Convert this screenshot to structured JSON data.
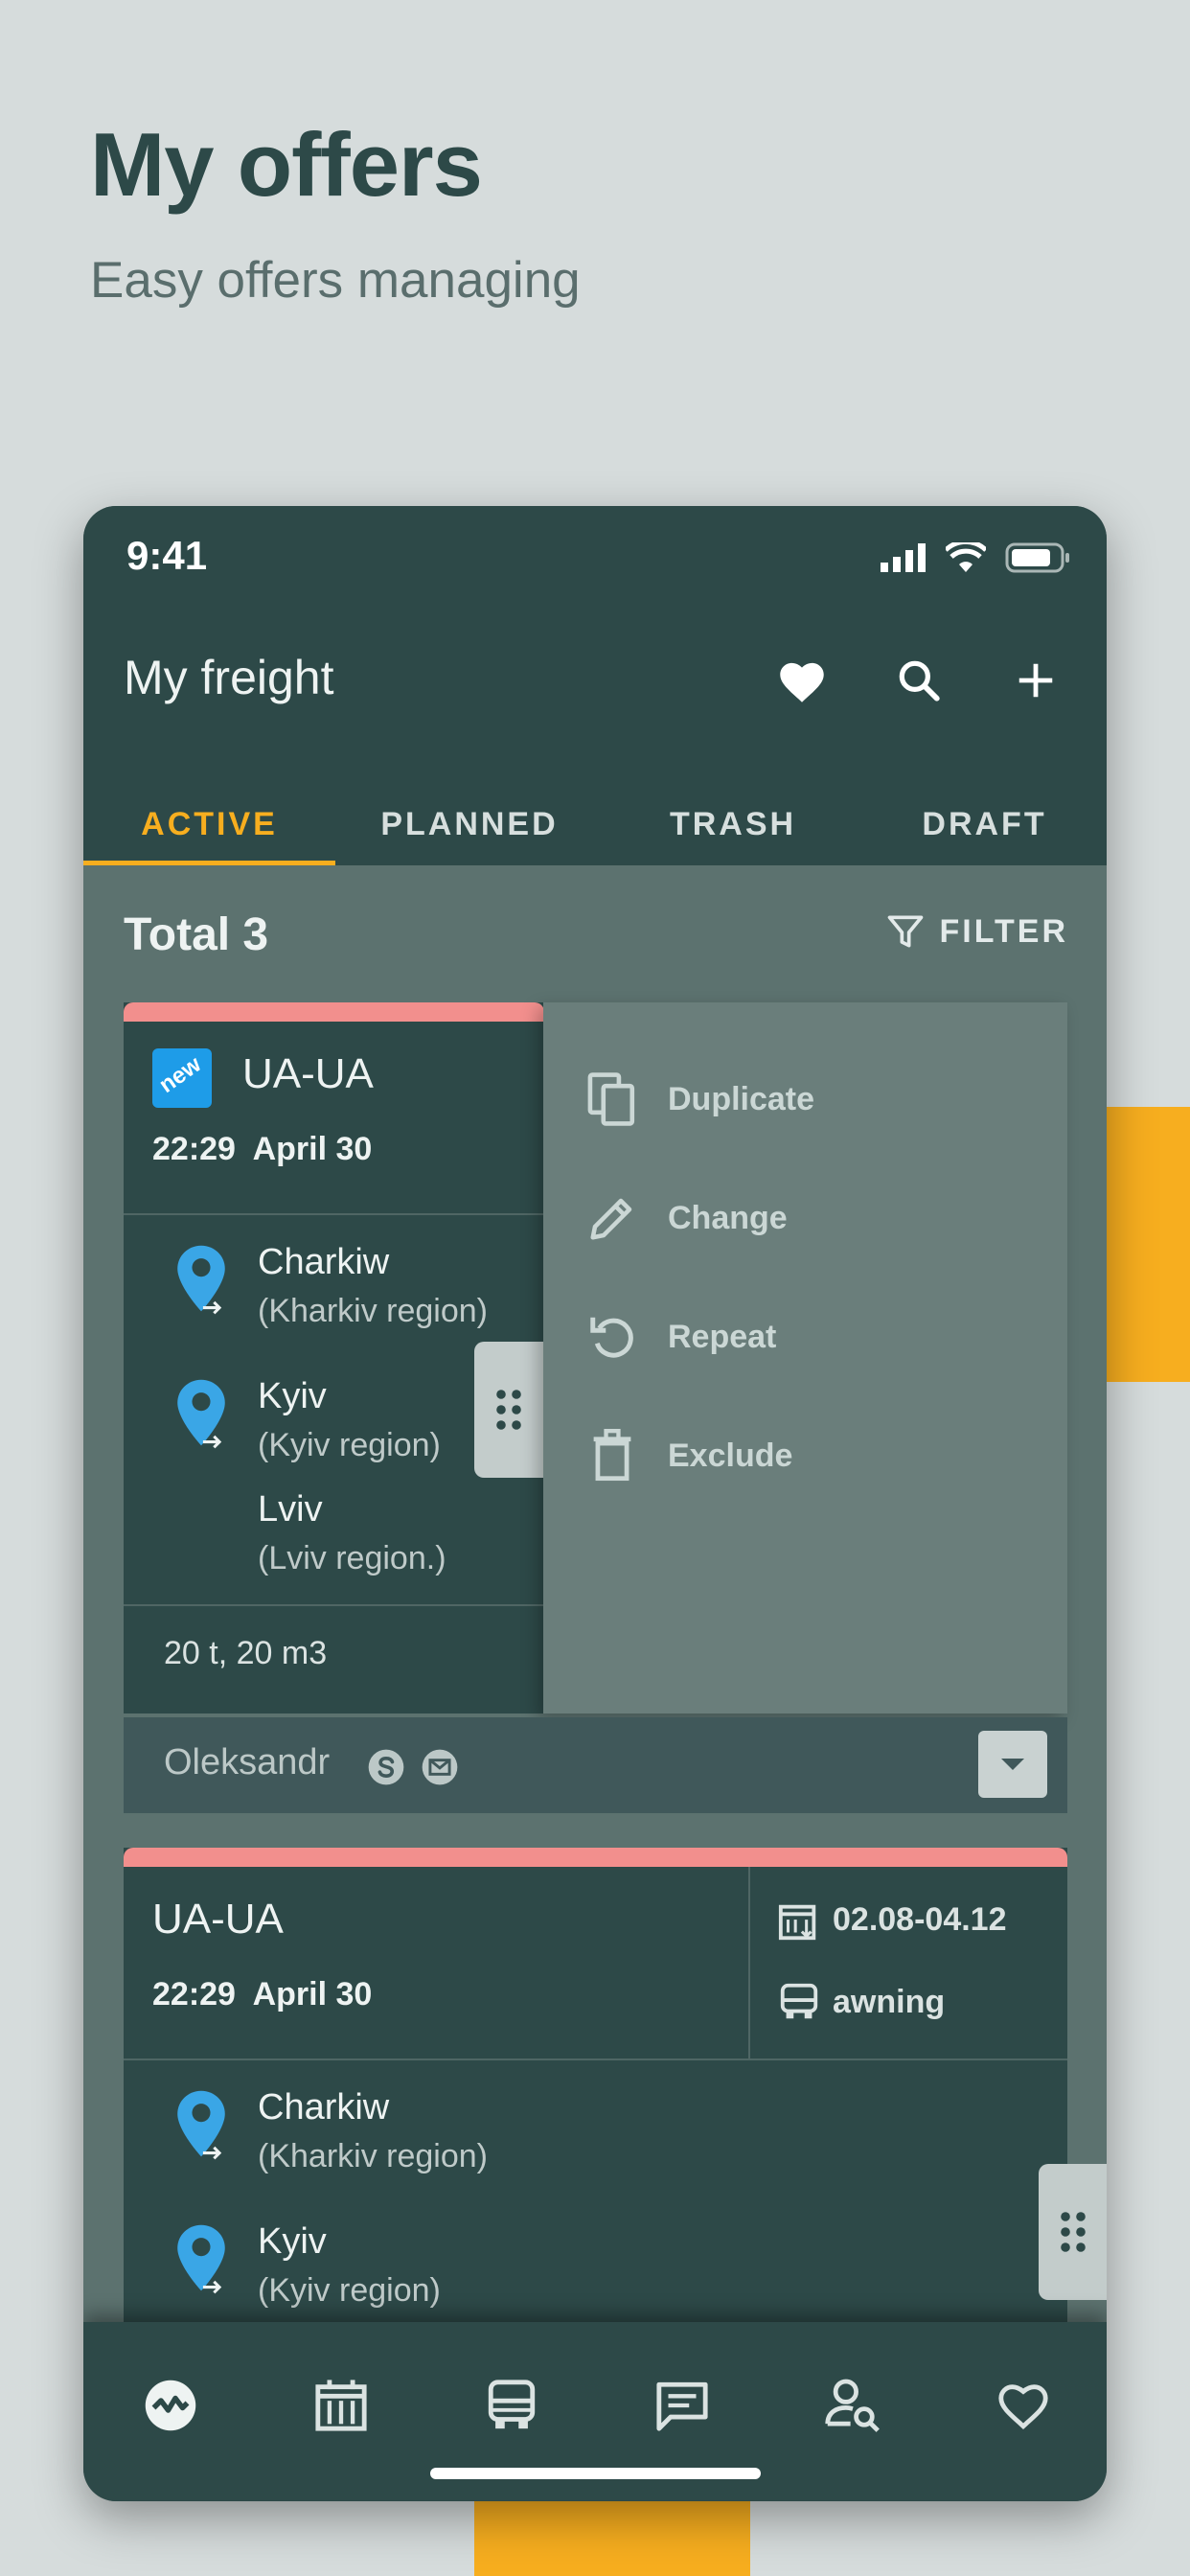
{
  "promo": {
    "title": "My offers",
    "subtitle": "Easy offers managing"
  },
  "status_bar": {
    "time": "9:41"
  },
  "app_bar": {
    "title": "My freight",
    "icons": [
      "heart-icon",
      "search-icon",
      "add-icon"
    ]
  },
  "tabs": [
    {
      "label": "ACTIVE",
      "active": true
    },
    {
      "label": "PLANNED",
      "active": false
    },
    {
      "label": "TRASH",
      "active": false
    },
    {
      "label": "DRAFT",
      "active": false
    }
  ],
  "list_header": {
    "total": "Total 3",
    "filter_label": "FILTER"
  },
  "offers": [
    {
      "badge": "new",
      "route_code": "UA-UA",
      "time": "22:29",
      "date": "April 30",
      "stops": [
        {
          "city": "Charkiw",
          "region": "(Kharkiv region)"
        },
        {
          "city": "Kyiv",
          "region": "(Kyiv region)"
        },
        {
          "city": "Lviv",
          "region": "(Lviv region.)"
        }
      ],
      "cargo": "20 t, 20 m3",
      "contact": "Oleksandr"
    },
    {
      "route_code": "UA-UA",
      "time": "22:29",
      "date": "April 30",
      "dates_range": "02.08-04.12",
      "vehicle_type": "awning",
      "stops": [
        {
          "city": "Charkiw",
          "region": "(Kharkiv region)"
        },
        {
          "city": "Kyiv",
          "region": "(Kyiv region)"
        }
      ]
    }
  ],
  "context_menu": [
    {
      "label": "Duplicate",
      "icon": "duplicate-icon"
    },
    {
      "label": "Change",
      "icon": "pencil-icon"
    },
    {
      "label": "Repeat",
      "icon": "repeat-icon"
    },
    {
      "label": "Exclude",
      "icon": "trash-icon"
    }
  ],
  "bottom_nav": [
    "activity-icon",
    "cargo-icon",
    "truck-icon",
    "chat-icon",
    "user-search-icon",
    "favorites-icon"
  ],
  "colors": {
    "primary": "#2d4948",
    "accent": "#f7ae1f",
    "stripe": "#f28f8d",
    "pin": "#3aa6e6",
    "background": "#d6dcdc"
  }
}
